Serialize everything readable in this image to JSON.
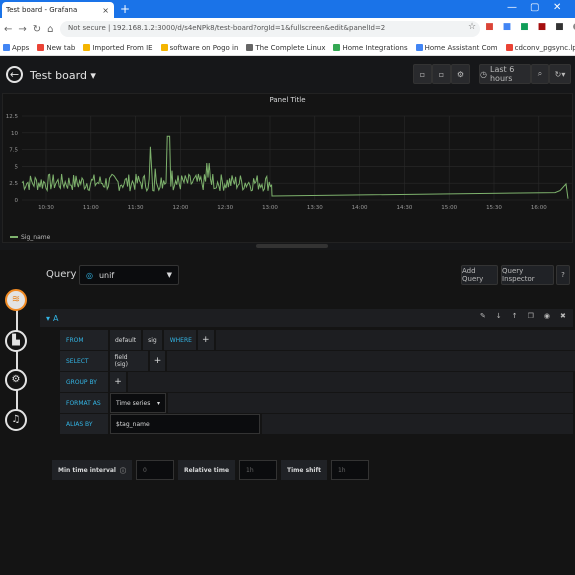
{
  "browser": {
    "tab_title": "Test board - Grafana",
    "tab_close": "×",
    "new_tab": "+",
    "url": "Not secure  |  192.168.1.2:3000/d/s4eNPk8/test-board?orgId=1&fullscreen&edit&panelId=2",
    "bookmarks": [
      {
        "label": "Apps",
        "color": "#4285f4"
      },
      {
        "label": "New tab",
        "color": "#ea4335"
      },
      {
        "label": "Imported From IE",
        "color": "#f4b400"
      },
      {
        "label": "software on Pogo in",
        "color": "#f4b400"
      },
      {
        "label": "The Complete Linux",
        "color": "#666666"
      },
      {
        "label": "Home Integrations",
        "color": "#34a853"
      },
      {
        "label": "Home Assistant Com",
        "color": "#4285f4"
      },
      {
        "label": "cdconv_pgsync.lpc",
        "color": "#ea4335"
      }
    ]
  },
  "header": {
    "title": "Test board ▾",
    "time_range": "Last 6 hours"
  },
  "panel": {
    "title": "Panel Title",
    "legend": "Sig_name",
    "y_ticks": [
      "12.5",
      "10",
      "7.5",
      "5",
      "2.5",
      "0"
    ],
    "x_ticks": [
      "10:30",
      "11:00",
      "11:30",
      "12:00",
      "12:30",
      "13:00",
      "13:30",
      "14:00",
      "14:30",
      "15:00",
      "15:30",
      "16:00",
      "16:30"
    ],
    "series_color": "#7eb26d"
  },
  "chart_data": {
    "type": "line",
    "title": "Panel Title",
    "series": [
      {
        "name": "Sig_name",
        "color": "#7eb26d"
      }
    ],
    "ylim": [
      0,
      12.5
    ],
    "y_ticks": [
      0,
      2.5,
      5,
      7.5,
      10,
      12.5
    ],
    "x_ticks": [
      "10:30",
      "11:00",
      "11:30",
      "12:00",
      "12:30",
      "13:00",
      "13:30",
      "14:00",
      "14:30",
      "15:00",
      "15:30",
      "16:00",
      "16:30"
    ],
    "grid": true,
    "legend_position": "bottom-left"
  },
  "query": {
    "label": "Query",
    "datasource": "unif",
    "add_query": "Add Query",
    "query_inspector": "Query Inspector",
    "ref_id": "A",
    "from_kw": "FROM",
    "from_policy": "default",
    "from_measurement": "sig",
    "where_kw": "WHERE",
    "select_kw": "SELECT",
    "select_field": "field (sig)",
    "group_kw": "GROUP BY",
    "format_kw": "FORMAT AS",
    "format_value": "Time series",
    "alias_kw": "ALIAS BY",
    "alias_value": "$tag_name",
    "min_interval_label": "Min time interval",
    "min_interval_placeholder": "0",
    "relative_time_label": "Relative time",
    "relative_time_placeholder": "1h",
    "time_shift_label": "Time shift",
    "time_shift_placeholder": "1h"
  }
}
